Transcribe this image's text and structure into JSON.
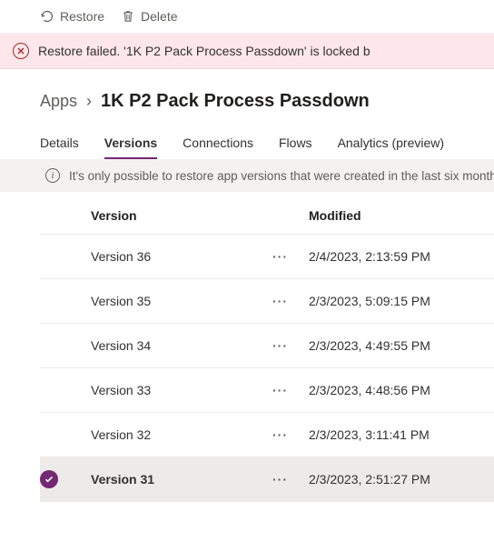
{
  "toolbar": {
    "restore_label": "Restore",
    "delete_label": "Delete"
  },
  "banner": {
    "text": "Restore failed. '1K P2 Pack Process Passdown' is locked b"
  },
  "breadcrumb": {
    "root": "Apps",
    "current": "1K P2 Pack Process Passdown"
  },
  "tabs": {
    "details": "Details",
    "versions": "Versions",
    "connections": "Connections",
    "flows": "Flows",
    "analytics": "Analytics (preview)"
  },
  "notice": "It's only possible to restore app versions that were created in the last six months",
  "headers": {
    "version": "Version",
    "modified": "Modified"
  },
  "rows": [
    {
      "name": "Version 36",
      "modified": "2/4/2023, 2:13:59 PM",
      "selected": false
    },
    {
      "name": "Version 35",
      "modified": "2/3/2023, 5:09:15 PM",
      "selected": false
    },
    {
      "name": "Version 34",
      "modified": "2/3/2023, 4:49:55 PM",
      "selected": false
    },
    {
      "name": "Version 33",
      "modified": "2/3/2023, 4:48:56 PM",
      "selected": false
    },
    {
      "name": "Version 32",
      "modified": "2/3/2023, 3:11:41 PM",
      "selected": false
    },
    {
      "name": "Version 31",
      "modified": "2/3/2023, 2:51:27 PM",
      "selected": true
    }
  ]
}
